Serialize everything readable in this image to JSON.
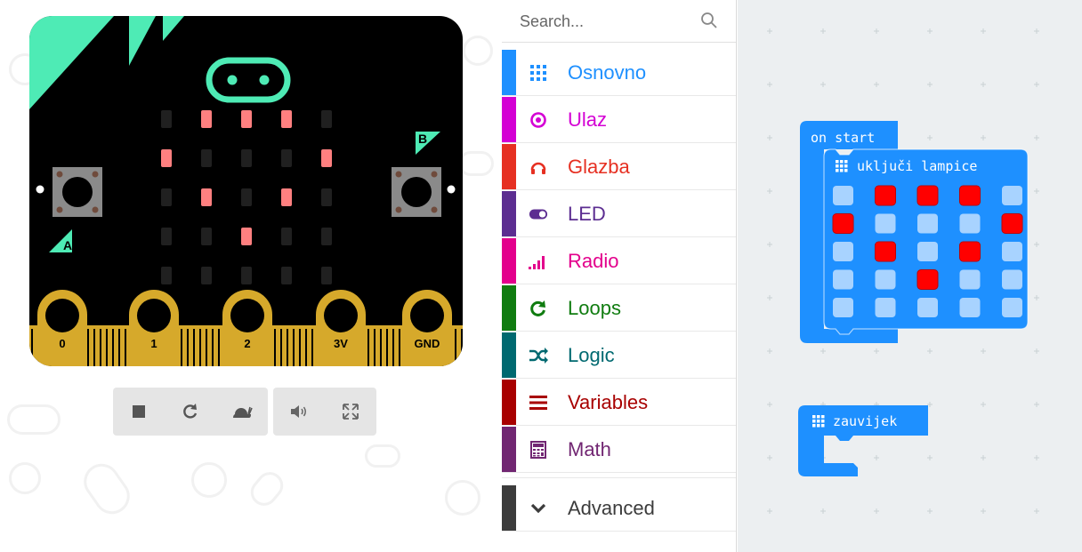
{
  "simulator": {
    "board": {
      "button_a_label": "A",
      "button_b_label": "B",
      "led_matrix": [
        [
          0,
          1,
          1,
          1,
          0
        ],
        [
          1,
          0,
          0,
          0,
          1
        ],
        [
          0,
          1,
          0,
          1,
          0
        ],
        [
          0,
          0,
          1,
          0,
          0
        ],
        [
          0,
          0,
          0,
          0,
          0
        ]
      ],
      "pins": [
        "0",
        "1",
        "2",
        "3V",
        "GND"
      ],
      "colors": {
        "accent": "#4eebb5",
        "body": "#000000",
        "led_on": "#ff8080",
        "led_off": "#202020",
        "pin": "#d6a92b"
      }
    },
    "toolbar": {
      "stop_icon": "stop-icon",
      "restart_icon": "restart-icon",
      "slowmo_icon": "snail-icon",
      "mute_icon": "speaker-icon",
      "fullscreen_icon": "fullscreen-icon"
    }
  },
  "toolbox": {
    "search": {
      "placeholder": "Search..."
    },
    "categories": [
      {
        "label": "Osnovno",
        "color": "#1e90ff",
        "icon": "grid-icon"
      },
      {
        "label": "Ulaz",
        "color": "#d400d4",
        "icon": "target-icon"
      },
      {
        "label": "Glazba",
        "color": "#e63022",
        "icon": "headphones-icon"
      },
      {
        "label": "LED",
        "color": "#5c2d91",
        "icon": "toggle-icon"
      },
      {
        "label": "Radio",
        "color": "#e3008c",
        "icon": "signal-icon"
      },
      {
        "label": "Loops",
        "color": "#107c10",
        "icon": "loop-icon"
      },
      {
        "label": "Logic",
        "color": "#006970",
        "icon": "shuffle-icon"
      },
      {
        "label": "Variables",
        "color": "#a80000",
        "icon": "lines-icon"
      },
      {
        "label": "Math",
        "color": "#712672",
        "icon": "calculator-icon"
      }
    ],
    "advanced": {
      "label": "Advanced",
      "color": "#3c3c3c",
      "icon": "chevron-down-icon"
    }
  },
  "workspace": {
    "on_start": {
      "label": "on start",
      "inner_label": "uključi lampice",
      "leds": [
        [
          0,
          1,
          1,
          1,
          0
        ],
        [
          1,
          0,
          0,
          0,
          1
        ],
        [
          0,
          1,
          0,
          1,
          0
        ],
        [
          0,
          0,
          1,
          0,
          0
        ],
        [
          0,
          0,
          0,
          0,
          0
        ]
      ]
    },
    "forever": {
      "label": "zauvijek"
    },
    "colors": {
      "block": "#1e90ff",
      "block_dark": "#1a7fe0",
      "led_on": "#ff0000",
      "led_off": "#a8d3ff"
    }
  }
}
